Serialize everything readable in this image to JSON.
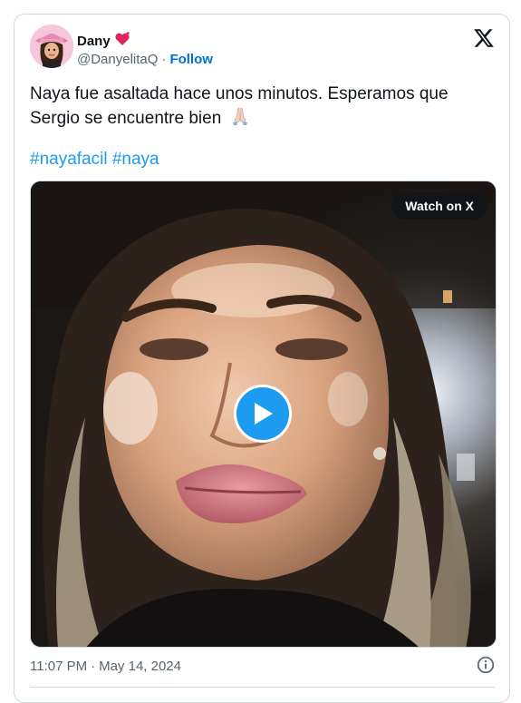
{
  "author": {
    "name": "Dany",
    "name_emoji": "heart-icon",
    "handle": "@DanyelitaQ",
    "separator": "·",
    "follow_label": "Follow"
  },
  "tweet": {
    "text_line1": "Naya fue asaltada hace unos minutos. Esperamos que",
    "text_line2": "Sergio se encuentre bien",
    "text_emoji": "praying-hands-icon",
    "hashtags": [
      "#nayafacil",
      "#naya"
    ]
  },
  "media": {
    "watch_label": "Watch on X",
    "play_icon": "play-icon"
  },
  "footer": {
    "time": "11:07 PM",
    "separator": "·",
    "date": "May 14, 2024",
    "info_icon": "info-icon"
  },
  "colors": {
    "accent": "#1d9bf0",
    "follow": "#006fd6",
    "secondary_text": "#536471",
    "border": "#cfd9de"
  }
}
